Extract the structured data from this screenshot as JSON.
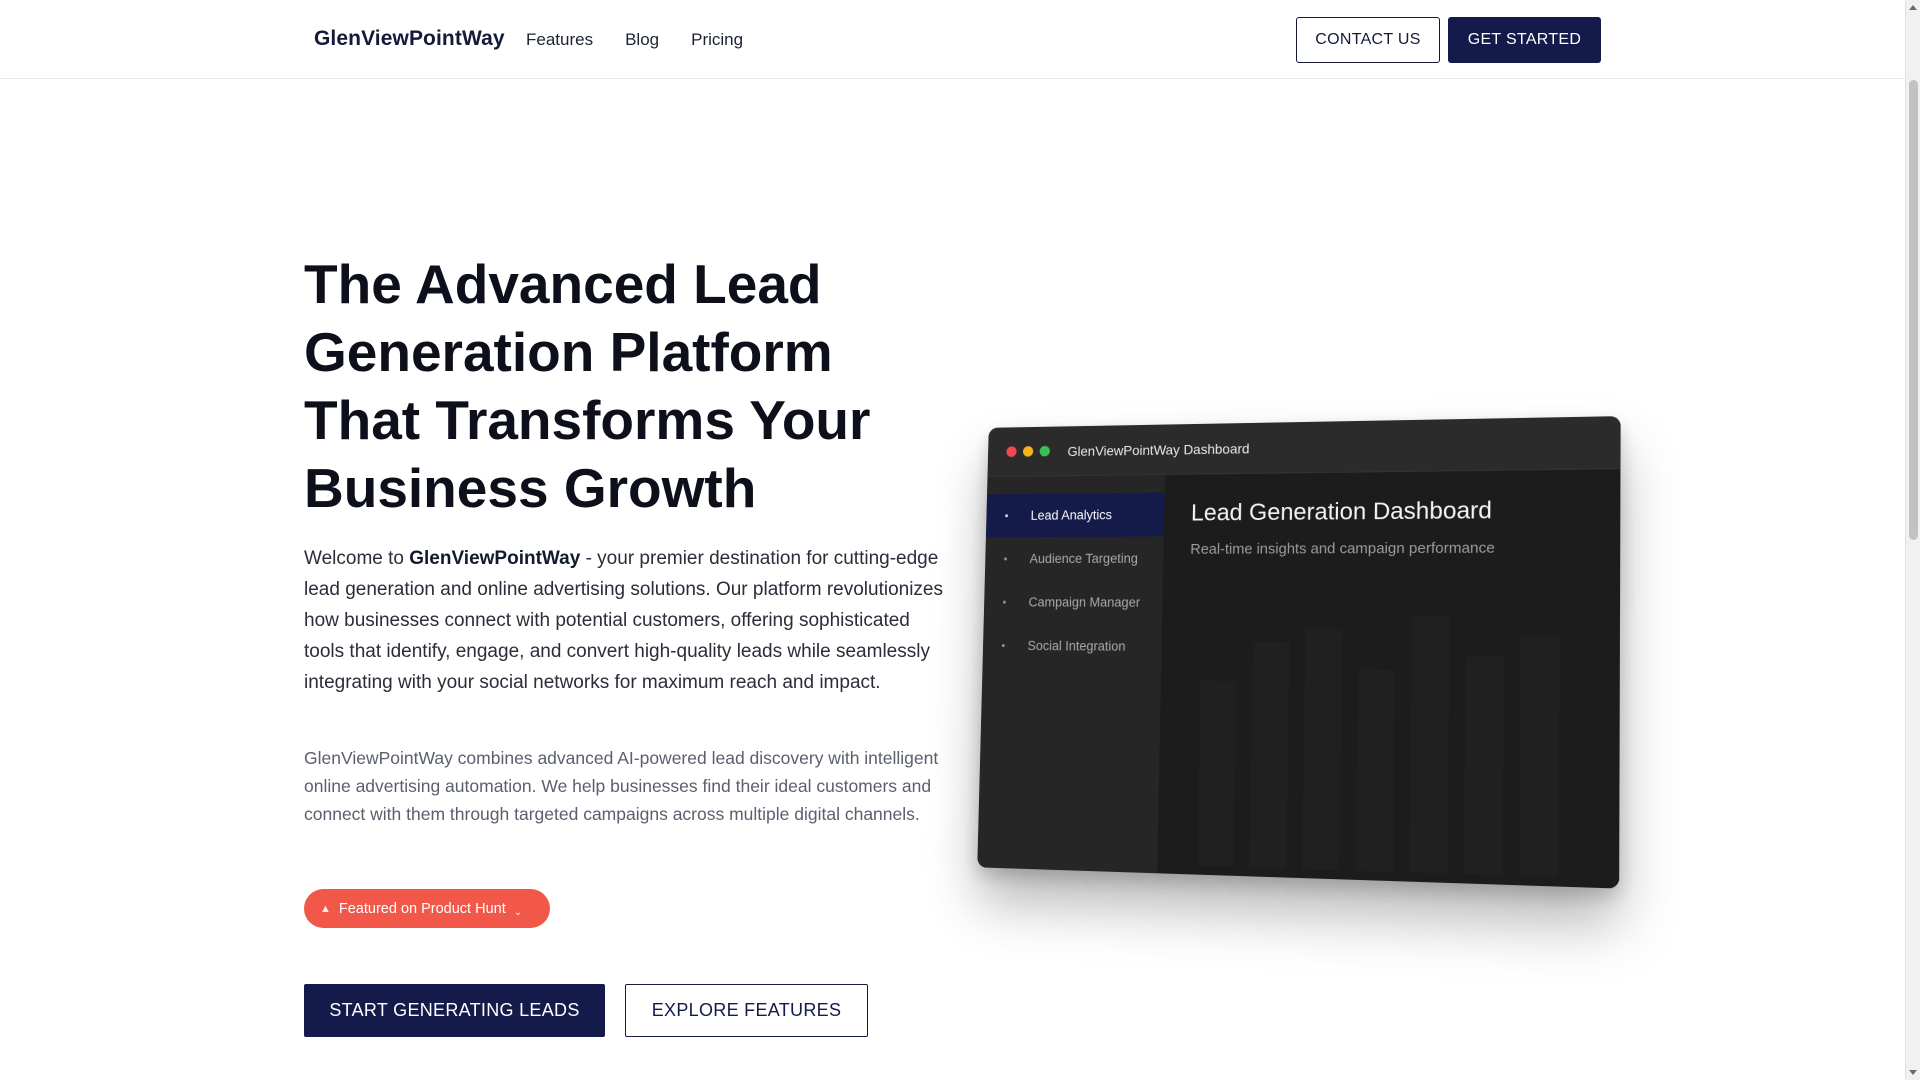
{
  "header": {
    "brand": "GlenViewPointWay",
    "nav": [
      "Features",
      "Blog",
      "Pricing"
    ],
    "contact_label": "CONTACT US",
    "get_started_label": "GET STARTED"
  },
  "hero": {
    "title": "The Advanced Lead Generation Platform That Transforms Your Business Growth",
    "intro_prefix": "Welcome to ",
    "intro_brand": "GlenViewPointWay",
    "intro_suffix": " - your premier destination for cutting-edge lead generation and online advertising solutions. Our platform revolutionizes how businesses connect with potential customers, offering sophisticated tools that identify, engage, and convert high-quality leads while seamlessly integrating with your social networks for maximum reach and impact.",
    "description": "GlenViewPointWay combines advanced AI-powered lead discovery with intelligent online advertising automation. We help businesses find their ideal customers and connect with them through targeted campaigns across multiple digital channels.",
    "badge_label": "Featured on Product Hunt",
    "primary_cta": "START GENERATING LEADS",
    "secondary_cta": "EXPLORE FEATURES"
  },
  "dashboard": {
    "window_title": "GlenViewPointWay Dashboard",
    "sidebar": [
      {
        "label": "Lead Analytics",
        "active": true
      },
      {
        "label": "Audience Targeting",
        "active": false
      },
      {
        "label": "Campaign Manager",
        "active": false
      },
      {
        "label": "Social Integration",
        "active": false
      }
    ],
    "heading": "Lead Generation Dashboard",
    "subheading": "Real-time insights and campaign performance"
  },
  "colors": {
    "primary": "#141a4a",
    "badge": "#f2584a",
    "dashboard_bg": "#1c1c1c"
  }
}
